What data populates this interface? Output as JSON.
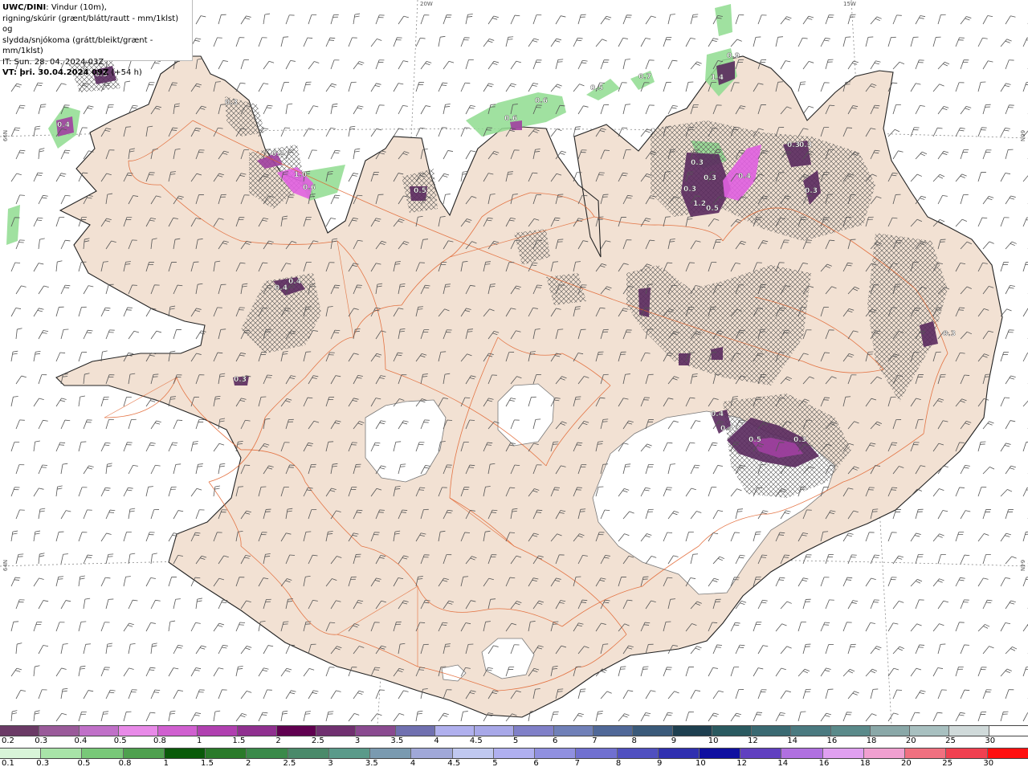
{
  "header": {
    "model": "UWC/DINI",
    "title_rest": ": Vindur (10m),",
    "line2": "rigning/skúrir (grænt/blátt/rautt - mm/1klst) og",
    "line3": "slydda/snjókoma (grátt/bleikt/grænt - mm/1klst)",
    "it_line": "IT: Sun. 28. 04. 2024 03Z",
    "vt_label": "VT: þri. 30.04.2024 09Z",
    "vt_offset": " (+54 h)"
  },
  "graticule": {
    "top_20w": "20W",
    "top_15w": "15W",
    "left_66n": "66N",
    "left_64n": "64N",
    "right_66n": "66N",
    "right_64n": "64N"
  },
  "colors": {
    "sea": "#ffffff",
    "land": "#f2e1d3",
    "coast": "#222222",
    "roads": "#e0602a",
    "glacier": "#ffffff",
    "wind_barb": "#555555",
    "snow_dark": "#5a2a5e",
    "snow_mid": "#a040a0",
    "snow_pink": "#e060e0",
    "rain_green": "#8fdc8f"
  },
  "precip_labels": [
    {
      "text": "0.5"
    },
    {
      "text": "0.3"
    },
    {
      "text": "0.4"
    },
    {
      "text": "0.2"
    },
    {
      "text": "1.0"
    },
    {
      "text": "0.6"
    },
    {
      "text": "0.5"
    },
    {
      "text": "0.6"
    },
    {
      "text": "0.5"
    },
    {
      "text": "0.6"
    },
    {
      "text": "0.7"
    },
    {
      "text": "0.9"
    },
    {
      "text": "1.4"
    },
    {
      "text": "0.3"
    },
    {
      "text": "0.4"
    },
    {
      "text": "0.4"
    },
    {
      "text": "0.3"
    },
    {
      "text": "0.3"
    },
    {
      "text": "0.3"
    },
    {
      "text": "0.3"
    },
    {
      "text": "0.3"
    },
    {
      "text": "1.2"
    },
    {
      "text": "0.5"
    },
    {
      "text": "0.4"
    },
    {
      "text": "0.3"
    },
    {
      "text": "0.3"
    },
    {
      "text": "0.4"
    },
    {
      "text": "0.5"
    },
    {
      "text": "0.3"
    },
    {
      "text": "0.4"
    }
  ],
  "legend_snow": {
    "labels": [
      "0.2",
      "0.3",
      "0.4",
      "0.5",
      "0.8",
      "1",
      "1.5",
      "2",
      "2.5",
      "3",
      "3.5",
      "4",
      "4.5",
      "5",
      "6",
      "7",
      "8",
      "9",
      "10",
      "12",
      "14",
      "16",
      "18",
      "20",
      "25",
      "30"
    ],
    "colors": [
      "#6b3a66",
      "#9a5a9a",
      "#c070c8",
      "#e88ae8",
      "#d060d0",
      "#b040b0",
      "#903090",
      "#600050",
      "#703070",
      "#8a4a90",
      "#7070b0",
      "#b0b0ee",
      "#a8a8e8",
      "#8080c8",
      "#7080b8",
      "#506898",
      "#3a5a7a",
      "#1e4050",
      "#2a5a60",
      "#3a6a72",
      "#4a7a80",
      "#5a8a8a",
      "#8aa8a8",
      "#a8c0c0",
      "#d0dada",
      "#ffffff"
    ]
  },
  "legend_rain": {
    "labels": [
      "0.1",
      "0.3",
      "0.5",
      "0.8",
      "1",
      "1.5",
      "2",
      "2.5",
      "3",
      "3.5",
      "4",
      "4.5",
      "5",
      "6",
      "7",
      "8",
      "9",
      "10",
      "12",
      "14",
      "16",
      "18",
      "20",
      "25",
      "30"
    ],
    "colors": [
      "#d8f4d8",
      "#a8e4a8",
      "#78c878",
      "#4ea04e",
      "#0a5a0a",
      "#2a7a2a",
      "#3a8a4a",
      "#4a8a6a",
      "#5a9a8a",
      "#7a9ab0",
      "#a0a8d8",
      "#c0c8f0",
      "#b0b0f0",
      "#9090e0",
      "#7070d0",
      "#5050c0",
      "#3030b0",
      "#1010a0",
      "#6040c0",
      "#b070e0",
      "#e0a0f0",
      "#f0a0d0",
      "#f07080",
      "#f04050",
      "#ff1010"
    ]
  }
}
